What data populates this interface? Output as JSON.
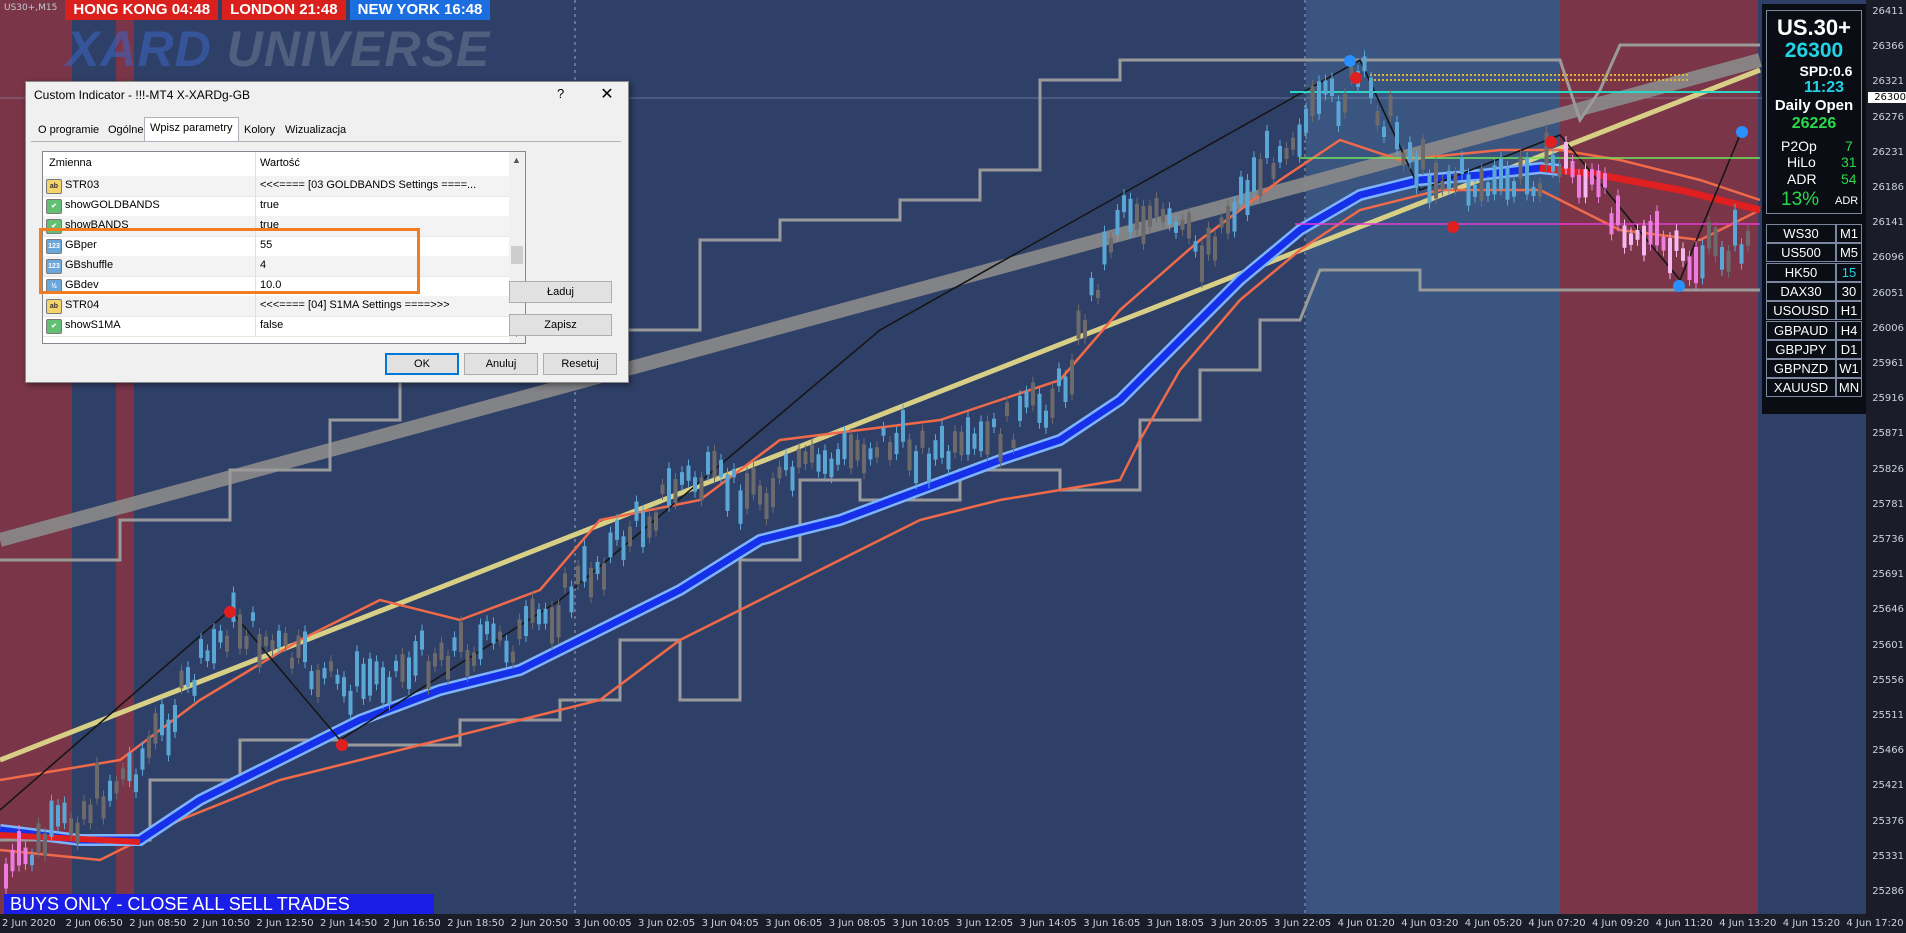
{
  "chart": {
    "symbol_timeframe": "US30+,M15",
    "logo_part1": "XARD",
    "logo_part2": " UNIVERSE",
    "clocks": [
      {
        "label": "HONG KONG 04:48",
        "color": "#d9201d"
      },
      {
        "label": "LONDON  21:48",
        "color": "#d9201d"
      },
      {
        "label": "NEW YORK 16:48",
        "color": "#1c6de0"
      }
    ],
    "banner": "BUYS ONLY - CLOSE ALL SELL TRADES",
    "price_axis": [
      "26411",
      "26366",
      "26321",
      "26276",
      "26231",
      "26186",
      "26141",
      "26096",
      "26051",
      "26006",
      "25961",
      "25916",
      "25871",
      "25826",
      "25781",
      "25736",
      "25691",
      "25646",
      "25601",
      "25556",
      "25511",
      "25466",
      "25421",
      "25376",
      "25331",
      "25286"
    ],
    "price_tag": "26300",
    "time_axis": [
      "2 Jun 2020",
      "2 Jun 06:50",
      "2 Jun 08:50",
      "2 Jun 10:50",
      "2 Jun 12:50",
      "2 Jun 14:50",
      "2 Jun 16:50",
      "2 Jun 18:50",
      "2 Jun 20:50",
      "3 Jun 00:05",
      "3 Jun 02:05",
      "3 Jun 04:05",
      "3 Jun 06:05",
      "3 Jun 08:05",
      "3 Jun 10:05",
      "3 Jun 12:05",
      "3 Jun 14:05",
      "3 Jun 16:05",
      "3 Jun 18:05",
      "3 Jun 20:05",
      "3 Jun 22:05",
      "4 Jun 01:20",
      "4 Jun 03:20",
      "4 Jun 05:20",
      "4 Jun 07:20",
      "4 Jun 09:20",
      "4 Jun 11:20",
      "4 Jun 13:20",
      "4 Jun 15:20",
      "4 Jun 17:20"
    ]
  },
  "panel": {
    "symbol": "US.30+",
    "price": "26300",
    "spread": "SPD:0.6",
    "time": "11:23",
    "daily_open_label": "Daily Open",
    "daily_open": "26226",
    "stats": [
      {
        "label": "P2Op",
        "value": "7"
      },
      {
        "label": "HiLo",
        "value": "31"
      },
      {
        "label": "ADR",
        "value": "54"
      }
    ],
    "adr_pct": "13%",
    "adr_small": "ADR",
    "symbols": [
      "WS30",
      "US500",
      "HK50",
      "DAX30",
      "USOUSD",
      "GBPAUD",
      "GBPJPY",
      "GBPNZD",
      "XAUUSD"
    ],
    "timeframes": [
      "M1",
      "M5",
      "15",
      "30",
      "H1",
      "H4",
      "D1",
      "W1",
      "MN"
    ]
  },
  "dialog": {
    "title": "Custom Indicator - !!!-MT4 X-XARDg-GB",
    "help": "?",
    "close": "✕",
    "tabs": [
      "O programie",
      "Ogólne",
      "Wpisz parametry",
      "Kolory",
      "Wizualizacja"
    ],
    "col_name": "Zmienna",
    "col_value": "Wartość",
    "rows": [
      {
        "icon": "ab",
        "name": "STR03",
        "value": "<<<==== [03 GOLDBANDS Settings ====..."
      },
      {
        "icon": "bool",
        "name": "showGOLDBANDS",
        "value": "true"
      },
      {
        "icon": "bool",
        "name": "showBANDS",
        "value": "true"
      },
      {
        "icon": "123",
        "name": "GBper",
        "value": "55"
      },
      {
        "icon": "123",
        "name": "GBshuffle",
        "value": "4"
      },
      {
        "icon": "1/2",
        "name": "GBdev",
        "value": "10.0"
      },
      {
        "icon": "ab",
        "name": "STR04",
        "value": "<<<==== [04] S1MA Settings ====>>>"
      },
      {
        "icon": "bool",
        "name": "showS1MA",
        "value": "false"
      }
    ],
    "load": "Ładuj",
    "save": "Zapisz",
    "ok": "OK",
    "cancel": "Anuluj",
    "reset": "Resetuj"
  }
}
